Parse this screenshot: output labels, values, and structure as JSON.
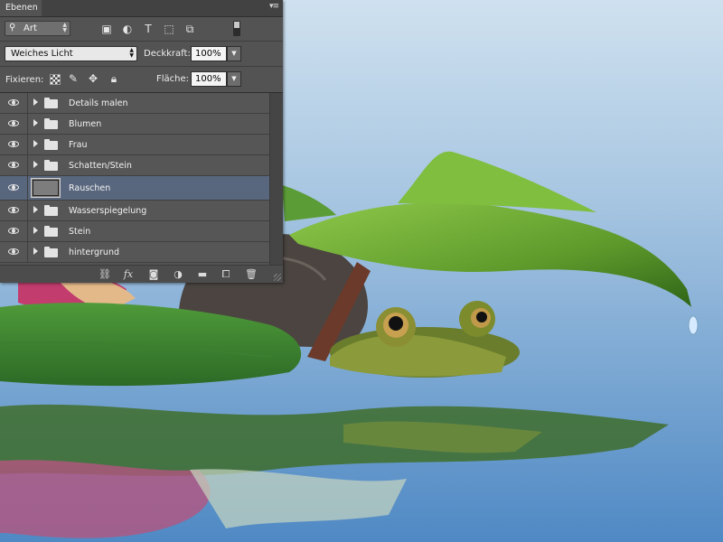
{
  "panel": {
    "tab_label": "Ebenen",
    "filter_kind": "Art",
    "blend_mode": "Weiches Licht",
    "opacity_label": "Deckkraft:",
    "opacity_value": "100%",
    "lock_label": "Fixieren:",
    "fill_label": "Fläche:",
    "fill_value": "100%",
    "filter_icons": [
      "image-filter-icon",
      "adjustment-filter-icon",
      "type-filter-icon",
      "shape-filter-icon",
      "smart-object-filter-icon"
    ],
    "lock_icons": [
      "lock-transparent-pixels-icon",
      "lock-image-pixels-icon",
      "lock-position-icon",
      "lock-all-icon"
    ]
  },
  "layers": [
    {
      "name": "Details malen",
      "type": "group",
      "visible": true
    },
    {
      "name": "Blumen",
      "type": "group",
      "visible": true
    },
    {
      "name": "Frau",
      "type": "group",
      "visible": true
    },
    {
      "name": "Schatten/Stein",
      "type": "group",
      "visible": true
    },
    {
      "name": "Rauschen",
      "type": "layer",
      "visible": true,
      "selected": true
    },
    {
      "name": "Wasserspiegelung",
      "type": "group",
      "visible": true
    },
    {
      "name": "Stein",
      "type": "group",
      "visible": true
    },
    {
      "name": "hintergrund",
      "type": "group",
      "visible": true
    }
  ],
  "bottom_icons": [
    "link-layers-icon",
    "fx-icon",
    "mask-icon",
    "adjustment-layer-icon",
    "new-group-icon",
    "new-layer-icon",
    "delete-icon"
  ],
  "colors": {
    "panel_bg": "#535353",
    "selected_layer": "#59677e",
    "water": "#6f9dc9",
    "leaf": "#5e9a2f"
  }
}
